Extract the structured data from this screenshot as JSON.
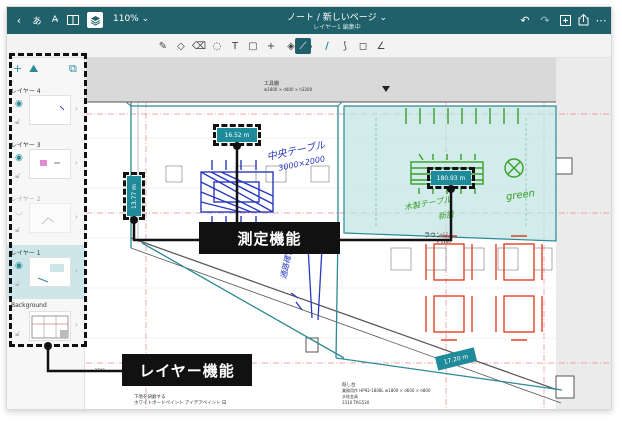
{
  "appbar": {
    "zoom": "110%",
    "title": "ノート /  新しいページ",
    "subtitle": "レイヤー1 編集中"
  },
  "layers": {
    "items": [
      {
        "label": "レイヤー 4",
        "dim": false,
        "selected": false
      },
      {
        "label": "レイヤー 3",
        "dim": false,
        "selected": false
      },
      {
        "label": "レイヤー 2",
        "dim": true,
        "selected": false
      },
      {
        "label": "レイヤー 1",
        "dim": false,
        "selected": true
      },
      {
        "label": "Background",
        "dim": false,
        "selected": false
      }
    ]
  },
  "callouts": {
    "measure": "測定機能",
    "layer": "レイヤー機能"
  },
  "measurements": {
    "m1": "16.52 m",
    "m2": "13.77 m",
    "m3": "180.93 m",
    "m4": "17.20 m"
  },
  "handwriting": {
    "center_table": "中央テーブル",
    "dims": "3000×2000",
    "wood_table": "木製テーブル",
    "wood_table2": "新設",
    "green": "green",
    "passage": "通路確保"
  },
  "plan_text": {
    "tool_shelf": "工具棚",
    "tool_shelf_dim": "w1800 × d400 × h2200",
    "ac_label": "AC",
    "note1": "下地を研磨する",
    "note2": "ホワイトボードペイント アイデアペイント 白",
    "note3": "既し台",
    "note4": "業務用作 HP92-1808L w1800 × d600 × h800",
    "note5": "水栓金具",
    "note6": "3310 TKG530",
    "dim_left": "× 3700",
    "space_label": "ラウンジ",
    "dim_small": "× 1100"
  },
  "colors": {
    "brand": "#20606a",
    "accent": "#2b8a96",
    "teal_area": "#bfe2e2",
    "red": "#e0402a",
    "blue": "#2a3ac0",
    "green": "#3aa02a"
  }
}
